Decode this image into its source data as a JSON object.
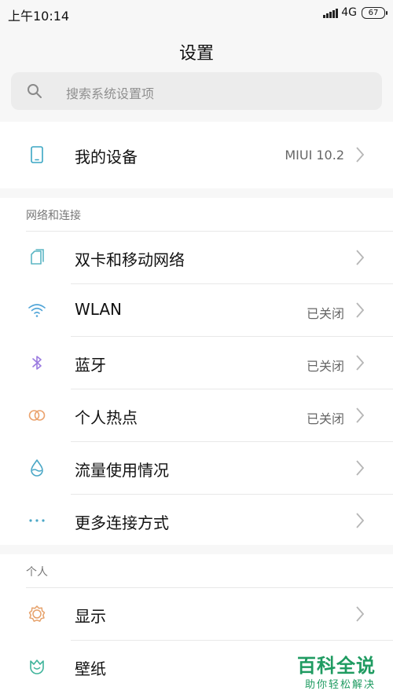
{
  "status": {
    "time": "上午10:14",
    "network": "4G",
    "battery": "67"
  },
  "header": {
    "title": "设置"
  },
  "search": {
    "placeholder": "搜索系统设置项"
  },
  "device": {
    "label": "我的设备",
    "value": "MIUI 10.2"
  },
  "sections": {
    "network": {
      "title": "网络和连接"
    },
    "personal": {
      "title": "个人"
    }
  },
  "rows": {
    "dual_sim": {
      "label": "双卡和移动网络"
    },
    "wlan": {
      "label": "WLAN",
      "value": "已关闭"
    },
    "bluetooth": {
      "label": "蓝牙",
      "value": "已关闭"
    },
    "hotspot": {
      "label": "个人热点",
      "value": "已关闭"
    },
    "data_usage": {
      "label": "流量使用情况"
    },
    "more_connection": {
      "label": "更多连接方式"
    },
    "display": {
      "label": "显示"
    },
    "wallpaper": {
      "label": "壁纸"
    }
  },
  "watermark": {
    "title": "百科全说",
    "subtitle": "助你轻松解决"
  },
  "colors": {
    "teal_icon": "#5bb6c4",
    "wifi_icon": "#53a6d8",
    "bluetooth_icon": "#9b7be0",
    "hotspot_icon": "#eba36e",
    "display_icon": "#e6a16a",
    "wallpaper_icon": "#3fb49b",
    "watermark_green": "#1f9b61"
  }
}
